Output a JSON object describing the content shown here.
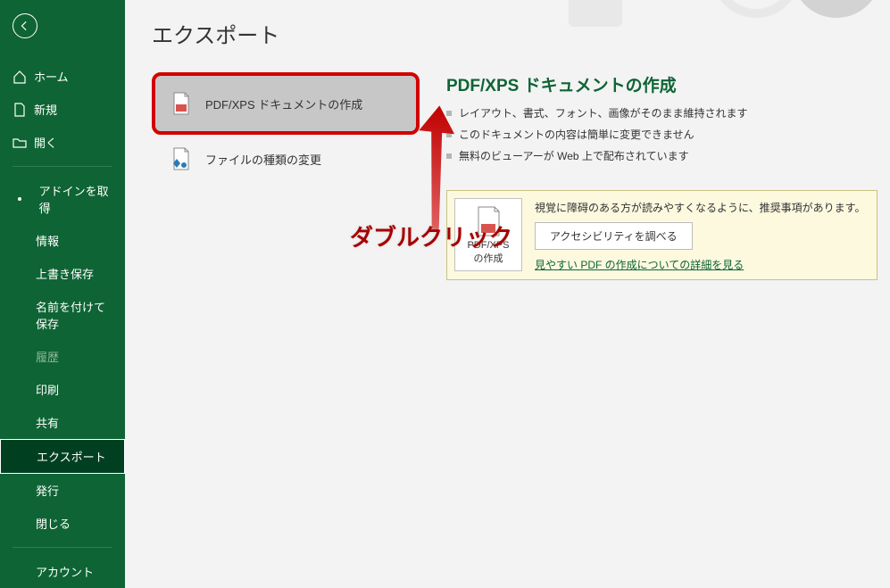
{
  "sidebar": {
    "home": "ホーム",
    "new": "新規",
    "open": "開く",
    "get_addins": "アドインを取得",
    "info": "情報",
    "save": "上書き保存",
    "save_as": "名前を付けて保存",
    "history": "履歴",
    "print": "印刷",
    "share": "共有",
    "export": "エクスポート",
    "publish": "発行",
    "close": "閉じる",
    "account": "アカウント"
  },
  "page": {
    "title": "エクスポート",
    "option_pdf": "PDF/XPS ドキュメントの作成",
    "option_change_type": "ファイルの種類の変更"
  },
  "detail": {
    "title": "PDF/XPS ドキュメントの作成",
    "bullets": [
      "レイアウト、書式、フォント、画像がそのまま維持されます",
      "このドキュメントの内容は簡単に変更できません",
      "無料のビューアーが Web 上で配布されています"
    ]
  },
  "accessibility": {
    "create_btn_line1": "PDF/XPS",
    "create_btn_line2": "の作成",
    "text": "視覚に障碍のある方が読みやすくなるように、推奨事項があります。",
    "check_btn": "アクセシビリティを調べる",
    "link": "見やすい PDF の作成についての詳細を見る"
  },
  "annotation": "ダブルクリック"
}
